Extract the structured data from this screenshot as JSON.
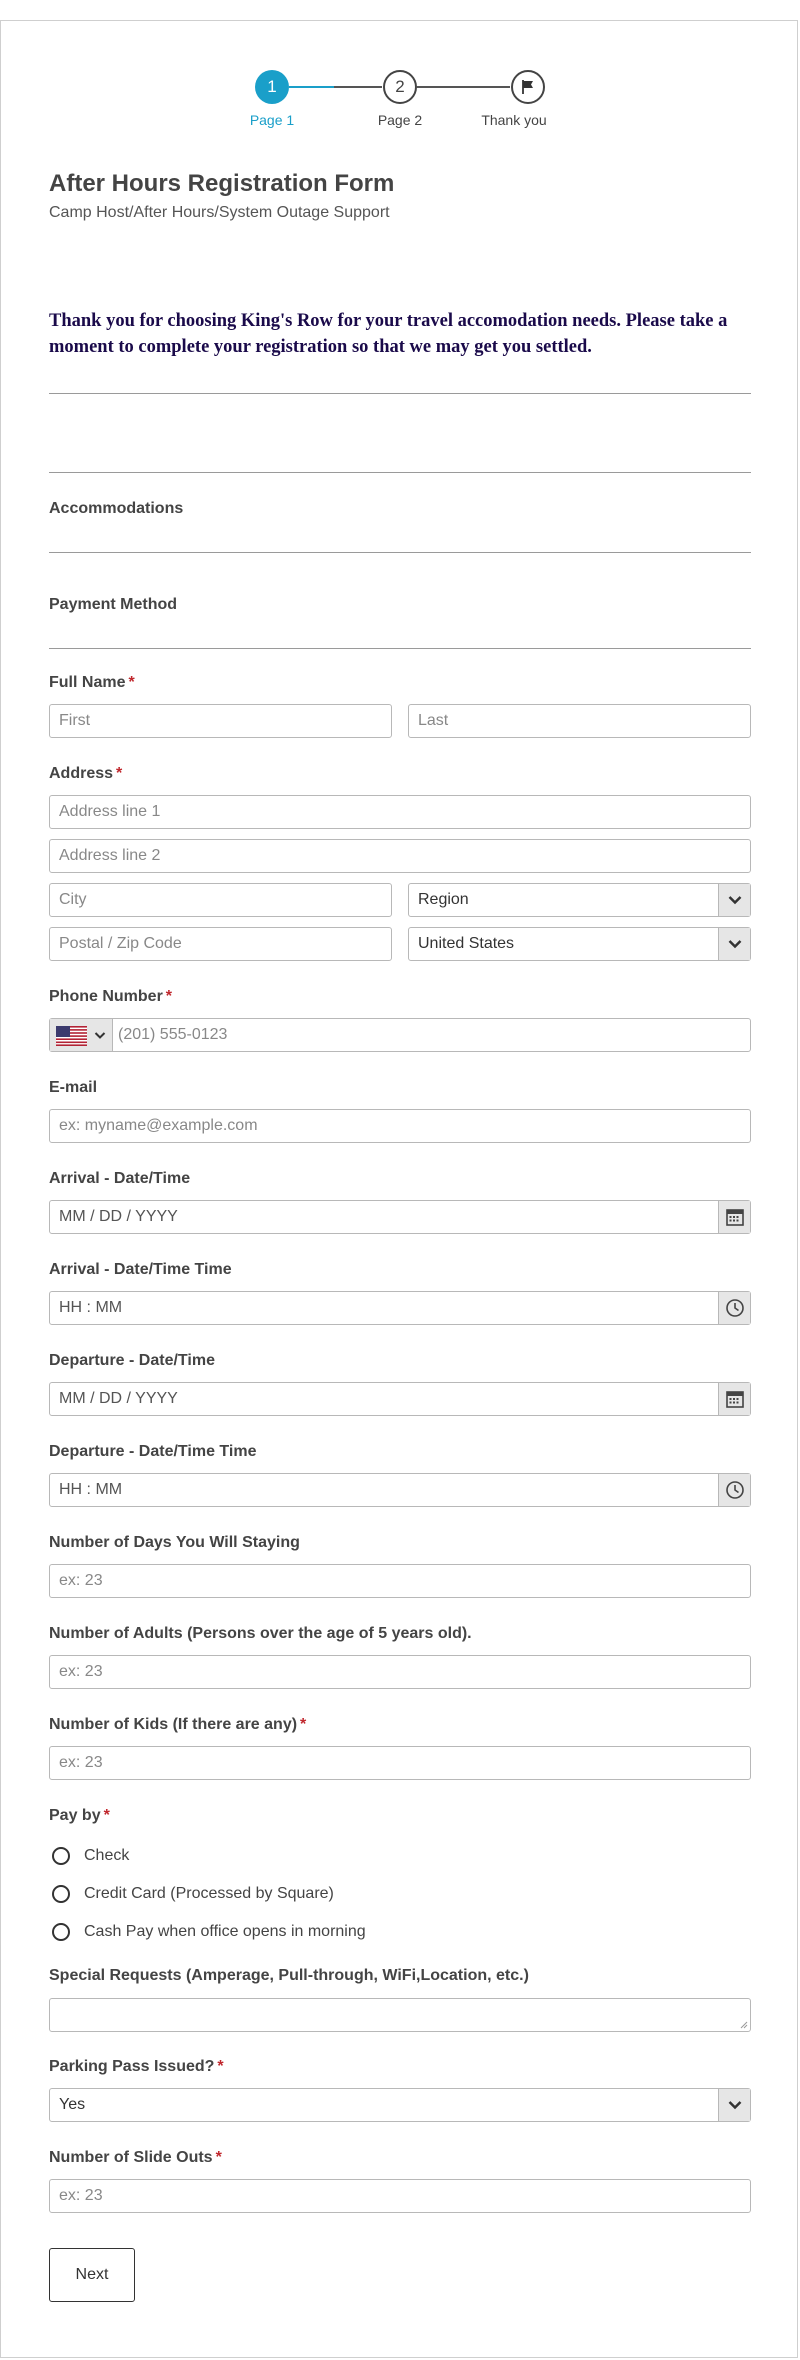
{
  "stepper": {
    "steps": [
      {
        "number": "1",
        "label": "Page 1"
      },
      {
        "number": "2",
        "label": "Page 2"
      },
      {
        "label": "Thank you",
        "icon": "flag-icon"
      }
    ],
    "active_color": "#1a9fc9"
  },
  "form": {
    "title": "After Hours Registration Form",
    "subtitle": "Camp Host/After Hours/System Outage Support",
    "intro": "Thank you for choosing King's Row for your travel accomodation needs. Please take a moment to complete your registration so that we may get you settled."
  },
  "sections": {
    "accommodations": "Accommodations",
    "payment_method": "Payment Method"
  },
  "fields": {
    "full_name": {
      "label": "Full Name",
      "first_placeholder": "First",
      "last_placeholder": "Last"
    },
    "address": {
      "label": "Address",
      "line1_placeholder": "Address line 1",
      "line2_placeholder": "Address line 2",
      "city_placeholder": "City",
      "region_value": "Region",
      "zip_placeholder": "Postal / Zip Code",
      "country_value": "United States"
    },
    "phone": {
      "label": "Phone Number",
      "placeholder": "(201) 555-0123",
      "flag_icon": "us-flag-icon"
    },
    "email": {
      "label": "E-mail",
      "placeholder": "ex: myname@example.com"
    },
    "arrival_date": {
      "label": "Arrival - Date/Time",
      "placeholder": "MM / DD / YYYY"
    },
    "arrival_time": {
      "label": "Arrival - Date/Time Time",
      "placeholder": "HH : MM"
    },
    "departure_date": {
      "label": "Departure - Date/Time",
      "placeholder": "MM / DD / YYYY"
    },
    "departure_time": {
      "label": "Departure - Date/Time Time",
      "placeholder": "HH : MM"
    },
    "days": {
      "label": "Number of Days You Will Staying",
      "placeholder": "ex: 23"
    },
    "adults": {
      "label": "Number of Adults (Persons over the age of 5 years old).",
      "placeholder": "ex: 23"
    },
    "kids": {
      "label": "Number of Kids (If there are any)",
      "placeholder": "ex: 23"
    },
    "pay_by": {
      "label": "Pay by",
      "options": [
        "Check",
        "Credit Card (Processed by Square)",
        "Cash Pay when office opens in morning"
      ]
    },
    "special_requests": {
      "label": "Special Requests (Amperage, Pull-through, WiFi,Location, etc.)"
    },
    "parking": {
      "label": "Parking Pass Issued?",
      "value": "Yes"
    },
    "slide_outs": {
      "label": "Number of Slide Outs",
      "placeholder": "ex: 23"
    }
  },
  "required_mark": "*",
  "next_button": "Next"
}
